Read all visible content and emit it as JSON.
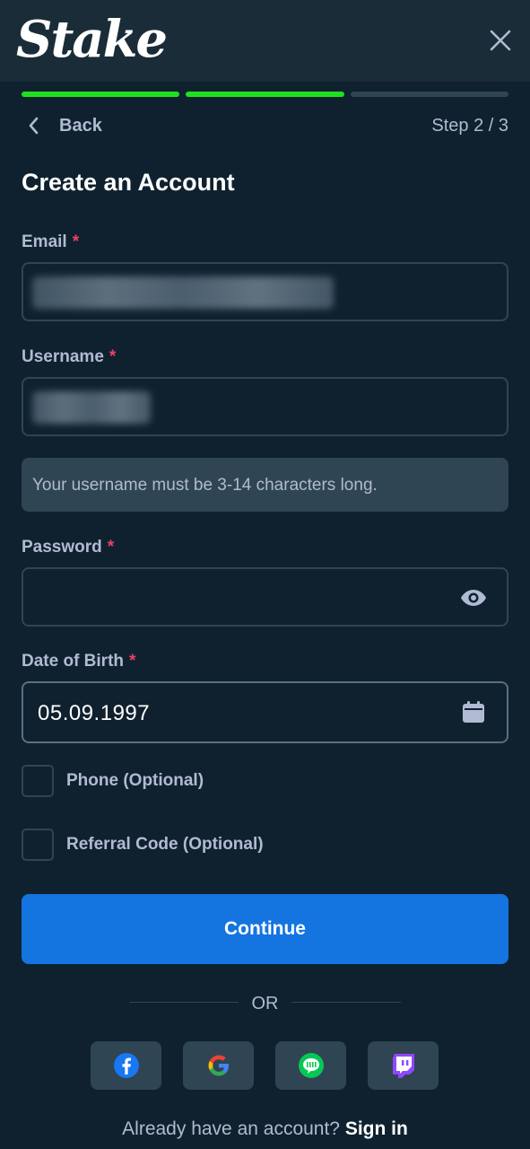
{
  "header": {
    "logo": "Stake",
    "close_icon": "close-icon"
  },
  "progress": {
    "current_step": 2,
    "total_steps": 3
  },
  "nav": {
    "back_label": "Back",
    "step_label": "Step 2 / 3"
  },
  "form": {
    "title": "Create an Account",
    "required_mark": "*",
    "email": {
      "label": "Email"
    },
    "username": {
      "label": "Username",
      "hint": "Your username must be 3-14 characters long."
    },
    "password": {
      "label": "Password",
      "toggle_icon": "eye-icon"
    },
    "dob": {
      "label": "Date of Birth",
      "value": "05.09.1997",
      "icon": "calendar-icon"
    },
    "phone_label": "Phone (Optional)",
    "referral_label": "Referral Code (Optional)",
    "continue_label": "Continue"
  },
  "divider": {
    "text": "OR"
  },
  "social": [
    {
      "name": "facebook-icon",
      "color": "#1877f2"
    },
    {
      "name": "google-icon",
      "color": "#4285f4"
    },
    {
      "name": "line-icon",
      "color": "#06c755"
    },
    {
      "name": "twitch-icon",
      "color": "#9146ff"
    }
  ],
  "footer": {
    "prompt": "Already have an account?",
    "link": "Sign in"
  },
  "colors": {
    "background": "#0f212e",
    "accent": "#1475e1",
    "progress": "#1fe01f",
    "required": "#ed4163"
  }
}
